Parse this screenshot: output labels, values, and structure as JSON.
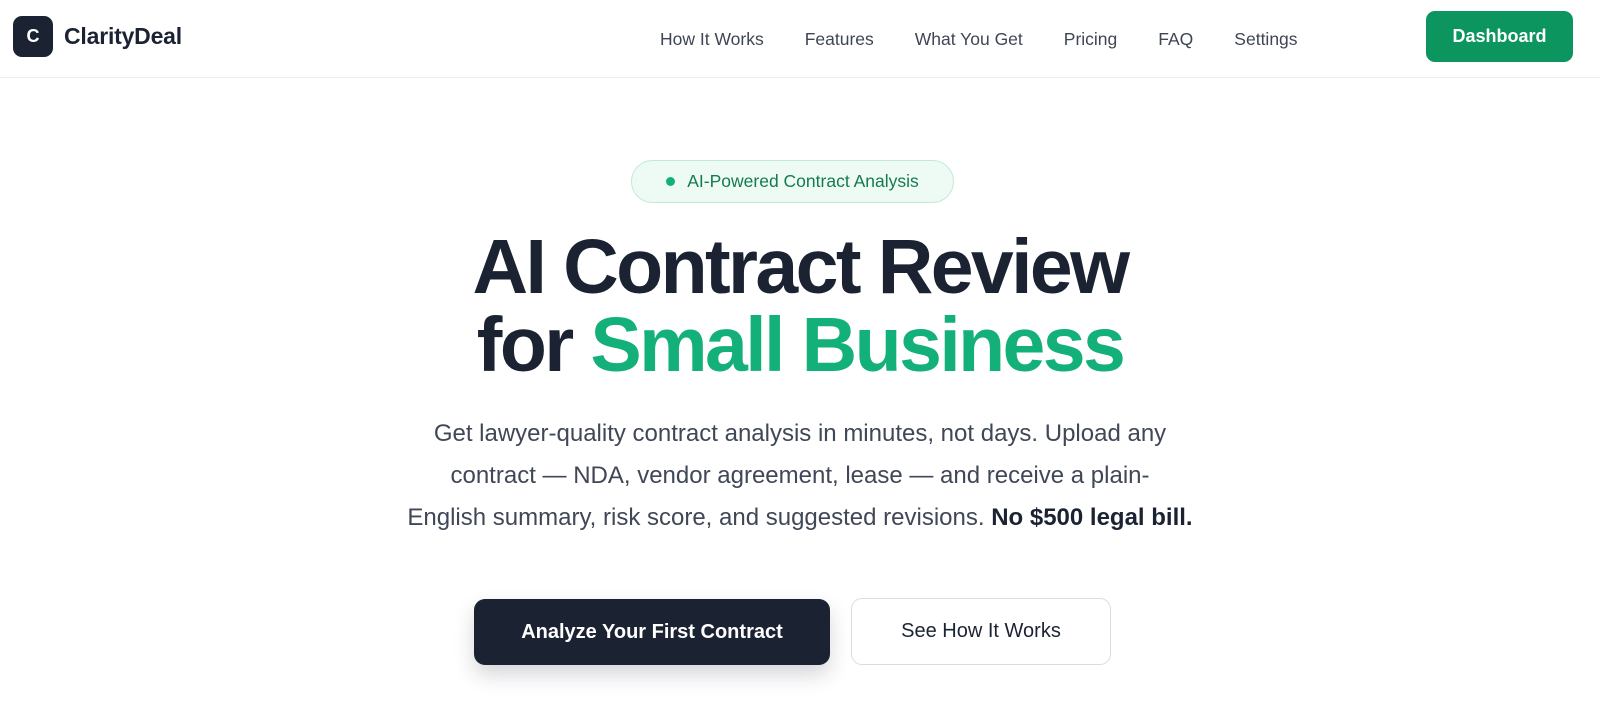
{
  "header": {
    "brand": {
      "mark": "C",
      "name": "ClarityDeal"
    },
    "nav": [
      {
        "label": "How It Works"
      },
      {
        "label": "Features"
      },
      {
        "label": "What You Get"
      },
      {
        "label": "Pricing"
      },
      {
        "label": "FAQ"
      },
      {
        "label": "Settings"
      }
    ],
    "dashboard_label": "Dashboard"
  },
  "hero": {
    "badge": "AI-Powered Contract Analysis",
    "headline": {
      "line1": "AI Contract Review",
      "line2_prefix": "for ",
      "line2_accent": "Small Business"
    },
    "subtitle": {
      "line1": "Get lawyer-quality contract analysis in minutes, not days. Upload any",
      "line2": "contract — NDA, vendor agreement, lease — and receive a plain-",
      "line3": "English summary, risk score, and suggested revisions. ",
      "line3_bold": "No $500 legal bill."
    },
    "cta_primary": "Analyze Your First Contract",
    "cta_secondary": "See How It Works"
  },
  "colors": {
    "brand_dark": "#1b2333",
    "accent_green": "#0d9560",
    "headline_accent": "#14b07a",
    "badge_bg": "#eefbf5",
    "badge_text": "#157a4f"
  }
}
